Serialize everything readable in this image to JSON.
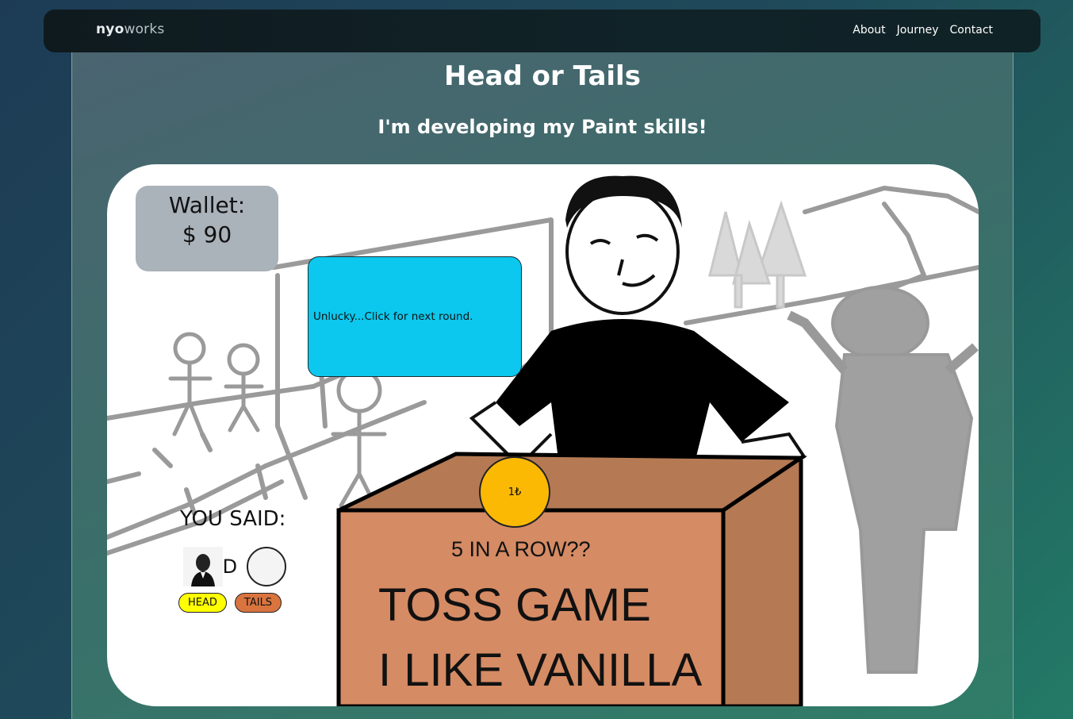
{
  "nav": {
    "brand_bold": "nyo",
    "brand_light": "works",
    "links": [
      "About",
      "Journey",
      "Contact"
    ]
  },
  "page": {
    "title": "Head or Tails",
    "subtitle": "I'm developing my Paint skills!"
  },
  "game": {
    "wallet_label": "Wallet:",
    "wallet_amount": "$ 90",
    "message": "Unlucky...Click for next round.",
    "you_said_label": "YOU SAID:",
    "you_said_value": "HEAD",
    "head_button": "HEAD",
    "tails_button": "TAILS",
    "coin_label": "1₺",
    "box_text_1": "5 IN A ROW??",
    "box_text_2": "TOSS GAME",
    "box_text_3": "I LIKE VANILLA"
  },
  "colors": {
    "message_bg": "#0cc8ee",
    "coin": "#fcb904",
    "head_button": "#ffff00",
    "tails_button": "#d9743f",
    "wallet_bg": "#aab2ba"
  }
}
